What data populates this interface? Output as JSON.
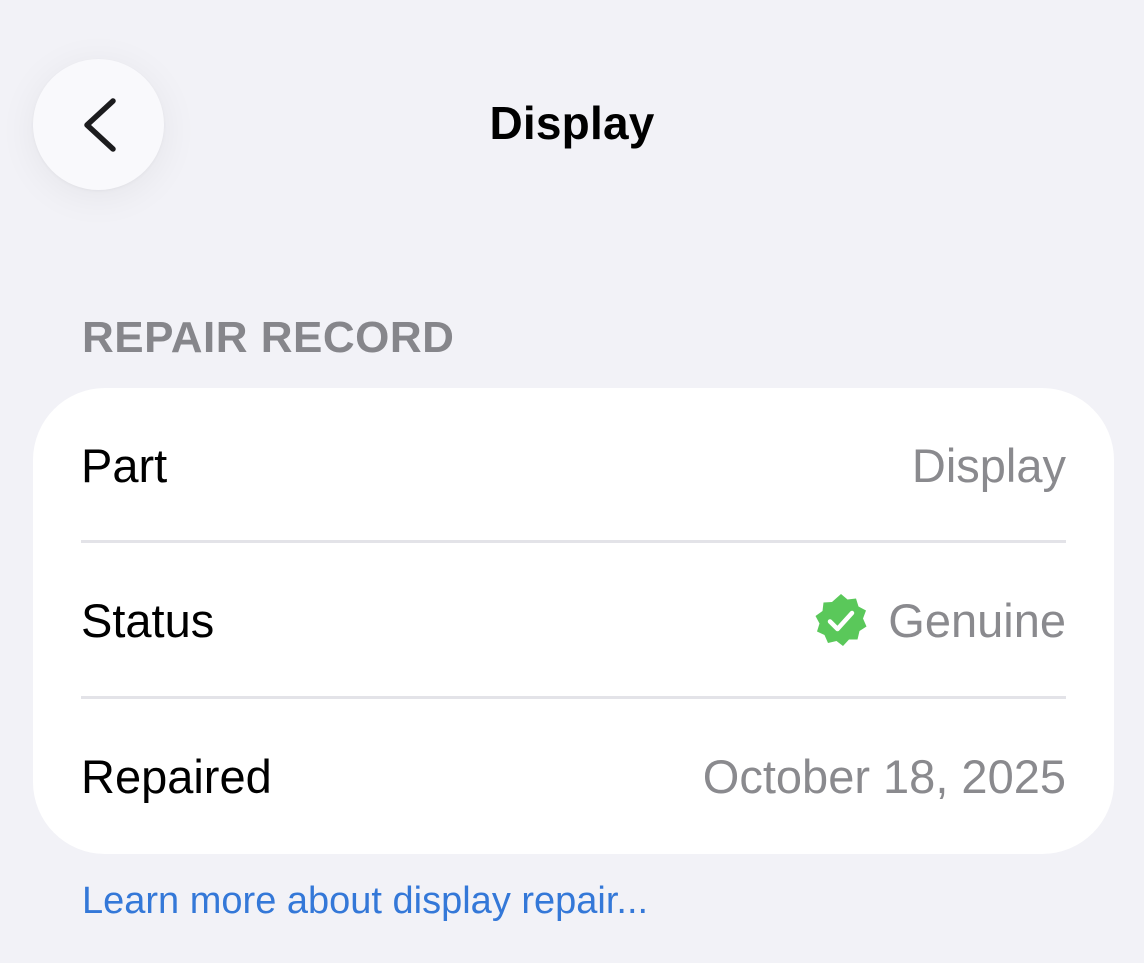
{
  "nav": {
    "title": "Display",
    "back_icon": "chevron-left-icon"
  },
  "section": {
    "header": "REPAIR RECORD"
  },
  "rows": [
    {
      "label": "Part",
      "value": "Display"
    },
    {
      "label": "Status",
      "value": "Genuine",
      "icon": "verified-badge-icon",
      "icon_color": "#5ac85a"
    },
    {
      "label": "Repaired",
      "value": "October 18, 2025"
    }
  ],
  "footer": {
    "link": "Learn more about display repair..."
  },
  "colors": {
    "background": "#f2f2f7",
    "card": "#ffffff",
    "secondary_text": "#8a8a8e",
    "link": "#3478d8",
    "badge_green": "#5ac85a"
  }
}
